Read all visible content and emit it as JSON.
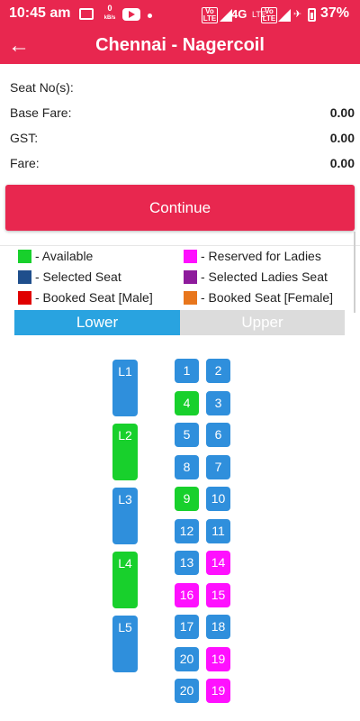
{
  "status_bar": {
    "time": "10:45 am",
    "data_rate_value": "0",
    "data_rate_unit": "kB/s",
    "volte1": "Vo LTE",
    "network": "4G",
    "network2": "LTE",
    "volte2": "Vo LTE",
    "battery": "37%"
  },
  "app_bar": {
    "back_icon": "←",
    "title": "Chennai - Nagercoil"
  },
  "fare": {
    "seat_label": "Seat No(s):",
    "base_fare_label": "Base Fare:",
    "base_fare_value": "0.00",
    "gst_label": "GST:",
    "gst_value": "0.00",
    "fare_label": "Fare:",
    "fare_value": "0.00"
  },
  "continue_label": "Continue",
  "legend": [
    {
      "label": "- Available",
      "color": "#18d02c"
    },
    {
      "label": "- Reserved for Ladies",
      "color": "#ff10ff"
    },
    {
      "label": "- Selected Seat",
      "color": "#1f4e8c"
    },
    {
      "label": "- Selected Ladies Seat",
      "color": "#8e1b9c"
    },
    {
      "label": "- Booked Seat [Male]",
      "color": "#e00000"
    },
    {
      "label": "- Booked Seat [Female]",
      "color": "#e8761c"
    }
  ],
  "tabs": {
    "lower": "Lower",
    "upper": "Upper"
  },
  "colors": {
    "brand": "#e8274f",
    "seat_blue": "#2f8fdc",
    "seat_green": "#18d02c",
    "seat_pink": "#ff10ff"
  },
  "sleepers": [
    {
      "label": "L1",
      "status": "blue"
    },
    {
      "label": "L2",
      "status": "green"
    },
    {
      "label": "L3",
      "status": "blue"
    },
    {
      "label": "L4",
      "status": "green"
    },
    {
      "label": "L5",
      "status": "blue"
    }
  ],
  "seat_rows": [
    [
      {
        "label": "1",
        "status": "blue"
      },
      {
        "label": "2",
        "status": "blue"
      }
    ],
    [
      {
        "label": "4",
        "status": "green"
      },
      {
        "label": "3",
        "status": "blue"
      }
    ],
    [
      {
        "label": "5",
        "status": "blue"
      },
      {
        "label": "6",
        "status": "blue"
      }
    ],
    [
      {
        "label": "8",
        "status": "blue"
      },
      {
        "label": "7",
        "status": "blue"
      }
    ],
    [
      {
        "label": "9",
        "status": "green"
      },
      {
        "label": "10",
        "status": "blue"
      }
    ],
    [
      {
        "label": "12",
        "status": "blue"
      },
      {
        "label": "11",
        "status": "blue"
      }
    ],
    [
      {
        "label": "13",
        "status": "blue"
      },
      {
        "label": "14",
        "status": "pink"
      }
    ],
    [
      {
        "label": "16",
        "status": "pink"
      },
      {
        "label": "15",
        "status": "pink"
      }
    ],
    [
      {
        "label": "17",
        "status": "blue"
      },
      {
        "label": "18",
        "status": "blue"
      }
    ],
    [
      {
        "label": "20",
        "status": "blue"
      },
      {
        "label": "19",
        "status": "pink"
      }
    ],
    [
      {
        "label": "20",
        "status": "blue"
      },
      {
        "label": "19",
        "status": "pink"
      }
    ]
  ]
}
